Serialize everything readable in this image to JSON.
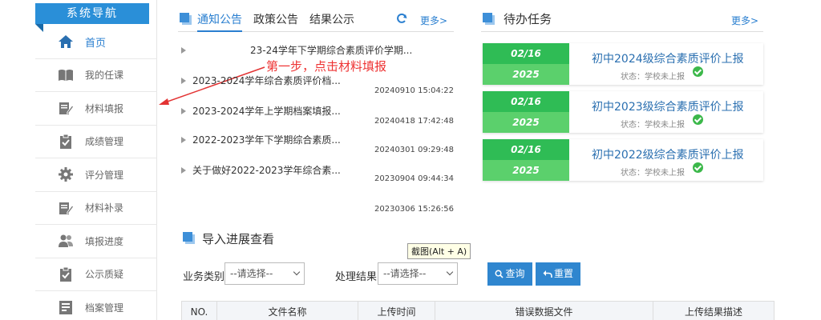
{
  "sidebar": {
    "title": "系统导航",
    "items": [
      {
        "label": "首页",
        "icon": "home-icon"
      },
      {
        "label": "我的任课",
        "icon": "book-icon"
      },
      {
        "label": "材料填报",
        "icon": "edit-icon"
      },
      {
        "label": "成绩管理",
        "icon": "clipboard-check-icon"
      },
      {
        "label": "评分管理",
        "icon": "gear-icon"
      },
      {
        "label": "材料补录",
        "icon": "edit-icon"
      },
      {
        "label": "填报进度",
        "icon": "users-icon"
      },
      {
        "label": "公示质疑",
        "icon": "clipboard-check-icon"
      },
      {
        "label": "档案管理",
        "icon": "archive-icon"
      }
    ]
  },
  "notices": {
    "tabs": [
      "通知公告",
      "政策公告",
      "结果公示"
    ],
    "more": "更多>",
    "items": [
      {
        "title": "23-24学年下学期综合素质评价学期...",
        "date": ""
      },
      {
        "title": "2023-2024学年综合素质评价档...",
        "date": "20240910 15:04:22"
      },
      {
        "title": "2023-2024学年上学期档案填报...",
        "date": "20240418 17:42:48"
      },
      {
        "title": "2022-2023学年下学期综合素质...",
        "date": "20240301 09:29:48"
      },
      {
        "title": "关于做好2022-2023学年综合素...",
        "date": "20230904 09:44:34"
      },
      {
        "title": "",
        "date": "20230306 15:26:56"
      }
    ]
  },
  "annotation": "第一步，点击材料填报",
  "tasks": {
    "title": "待办任务",
    "more": "更多>",
    "items": [
      {
        "date": "02/16",
        "year": "2025",
        "name": "初中2024级综合素质评价上报",
        "status": "状态：学校未上报"
      },
      {
        "date": "02/16",
        "year": "2025",
        "name": "初中2023级综合素质评价上报",
        "status": "状态：学校未上报"
      },
      {
        "date": "02/16",
        "year": "2025",
        "name": "初中2022级综合素质评价上报",
        "status": "状态：学校未上报"
      }
    ]
  },
  "import": {
    "title": "导入进展查看",
    "tooltip": "截图(Alt + A)",
    "filters": [
      {
        "label": "业务类别",
        "value": "--请选择--"
      },
      {
        "label": "处理结果",
        "value": "--请选择--"
      }
    ],
    "query_button": "查询",
    "reset_button": "重置",
    "columns": [
      "NO.",
      "文件名称",
      "上传时间",
      "错误数据文件",
      "上传结果描述"
    ]
  },
  "colors": {
    "accent": "#2a7fd0",
    "task_green": "#2fbc55",
    "task_green_light": "#5bd06c",
    "annotation_red": "#e33333"
  }
}
